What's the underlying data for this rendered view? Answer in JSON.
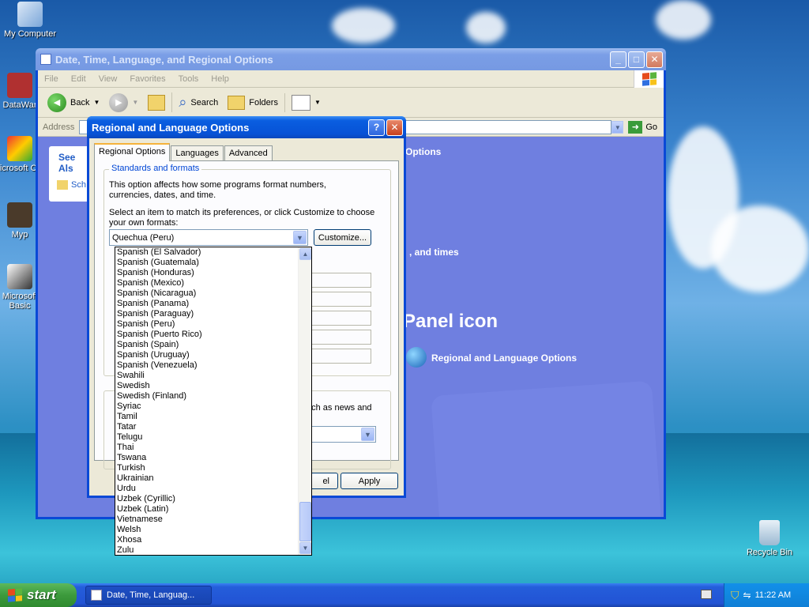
{
  "desktop": {
    "icons": [
      {
        "label": "My Computer"
      },
      {
        "label": "DataWar"
      },
      {
        "label": "Microsoft C++"
      },
      {
        "label": "Myp"
      },
      {
        "label": "Microsoft Basic"
      },
      {
        "label": "Recycle Bin"
      }
    ]
  },
  "explorer": {
    "title": "Date, Time, Language, and Regional Options",
    "menu": [
      "File",
      "Edit",
      "View",
      "Favorites",
      "Tools",
      "Help"
    ],
    "toolbar": {
      "back": "Back",
      "search": "Search",
      "folders": "Folders"
    },
    "address_label": "Address",
    "go_label": "Go",
    "see_also": "See Als",
    "see_also_item": "Sch",
    "options_heading": "Options",
    "task_fragment": ", and times",
    "panel_icon_heading": "Panel icon",
    "cp_item": "Regional and Language Options"
  },
  "dialog": {
    "title": "Regional and Language Options",
    "tabs": [
      "Regional Options",
      "Languages",
      "Advanced"
    ],
    "group_title": "Standards and formats",
    "desc1": "This option affects how some programs format numbers, currencies, dates, and time.",
    "desc2": "Select an item to match its preferences, or click Customize to choose your own formats:",
    "selected_format": "Quechua (Peru)",
    "customize_label": "Customize...",
    "location_fragment": "uch as news and",
    "cancel_fragment": "el",
    "apply_label": "Apply"
  },
  "dropdown": {
    "items": [
      "Spanish (El Salvador)",
      "Spanish (Guatemala)",
      "Spanish (Honduras)",
      "Spanish (Mexico)",
      "Spanish (Nicaragua)",
      "Spanish (Panama)",
      "Spanish (Paraguay)",
      "Spanish (Peru)",
      "Spanish (Puerto Rico)",
      "Spanish (Spain)",
      "Spanish (Uruguay)",
      "Spanish (Venezuela)",
      "Swahili",
      "Swedish",
      "Swedish (Finland)",
      "Syriac",
      "Tamil",
      "Tatar",
      "Telugu",
      "Thai",
      "Tswana",
      "Turkish",
      "Ukrainian",
      "Urdu",
      "Uzbek (Cyrillic)",
      "Uzbek (Latin)",
      "Vietnamese",
      "Welsh",
      "Xhosa",
      "Zulu"
    ],
    "scroll_position": 1.0
  },
  "taskbar": {
    "start_label": "start",
    "task_label": "Date, Time, Languag...",
    "clock": "11:22 AM"
  }
}
